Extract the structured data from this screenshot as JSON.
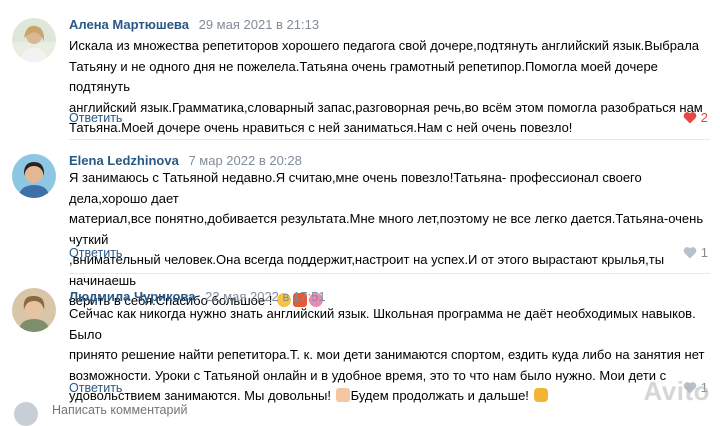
{
  "comments": [
    {
      "author": "Алена Мартюшева",
      "date": "29 мая 2021 в 21:13",
      "lines": [
        "Искала из множества репетиторов хорошего педагога свой дочере,подтянуть английский язык.Выбрала",
        "Татьяну и не одного дня не пожелела.Татьяна очень грамотный репетипор.Помогла моей дочере подтянуть",
        "английский язык.Грамматика,словарный запас,разговорная речь,во всём этом помогла разобраться нам",
        "Татьяна.Моей дочере очень нравиться с ней заниматься.Нам с ней очень повезло!"
      ],
      "reply_label": "Ответить",
      "likes": "2",
      "liked": true
    },
    {
      "author": "Elena Ledzhinova",
      "date": "7 мар 2022 в 20:28",
      "lines": [
        "Я занимаюсь с Татьяной недавно.Я считаю,мне очень повезло!Татьяна- профессионал своего дела,хорошо дает",
        "материал,все понятно,добивается результата.Мне много лет,поэтому не все легко дается.Татьяна-очень чуткий",
        ",внимательный человек.Она всегда поддержит,настроит на успех.И от этого вырастают крылья,ты начинаешь",
        "верить в себя.Спасибо большое !"
      ],
      "reply_label": "Ответить",
      "likes": "1",
      "liked": false
    },
    {
      "author": "Людмила Чурикова",
      "date": "22 мая 2022 в 17:51",
      "lines": [
        "Сейчас как никогда нужно знать английский язык. Школьная программа не даёт необходимых навыков. Было",
        "принято решение найти репетитора.Т. к. мои дети занимаются спортом, ездить куда либо на занятия нет",
        "возможности. Уроки с Татьяной онлайн и в удобное время, это то что нам было нужно. Мои дети с",
        "удовольствием занимаются. Мы довольны!",
        "Будем продолжать и дальше!"
      ],
      "reply_label": "Ответить",
      "likes": "1",
      "liked": false
    }
  ],
  "compose": {
    "placeholder": "Написать комментарий"
  },
  "watermark": "Avito",
  "colors": {
    "author": "#2a5885",
    "meta": "#818c99",
    "like_active": "#e64646"
  }
}
